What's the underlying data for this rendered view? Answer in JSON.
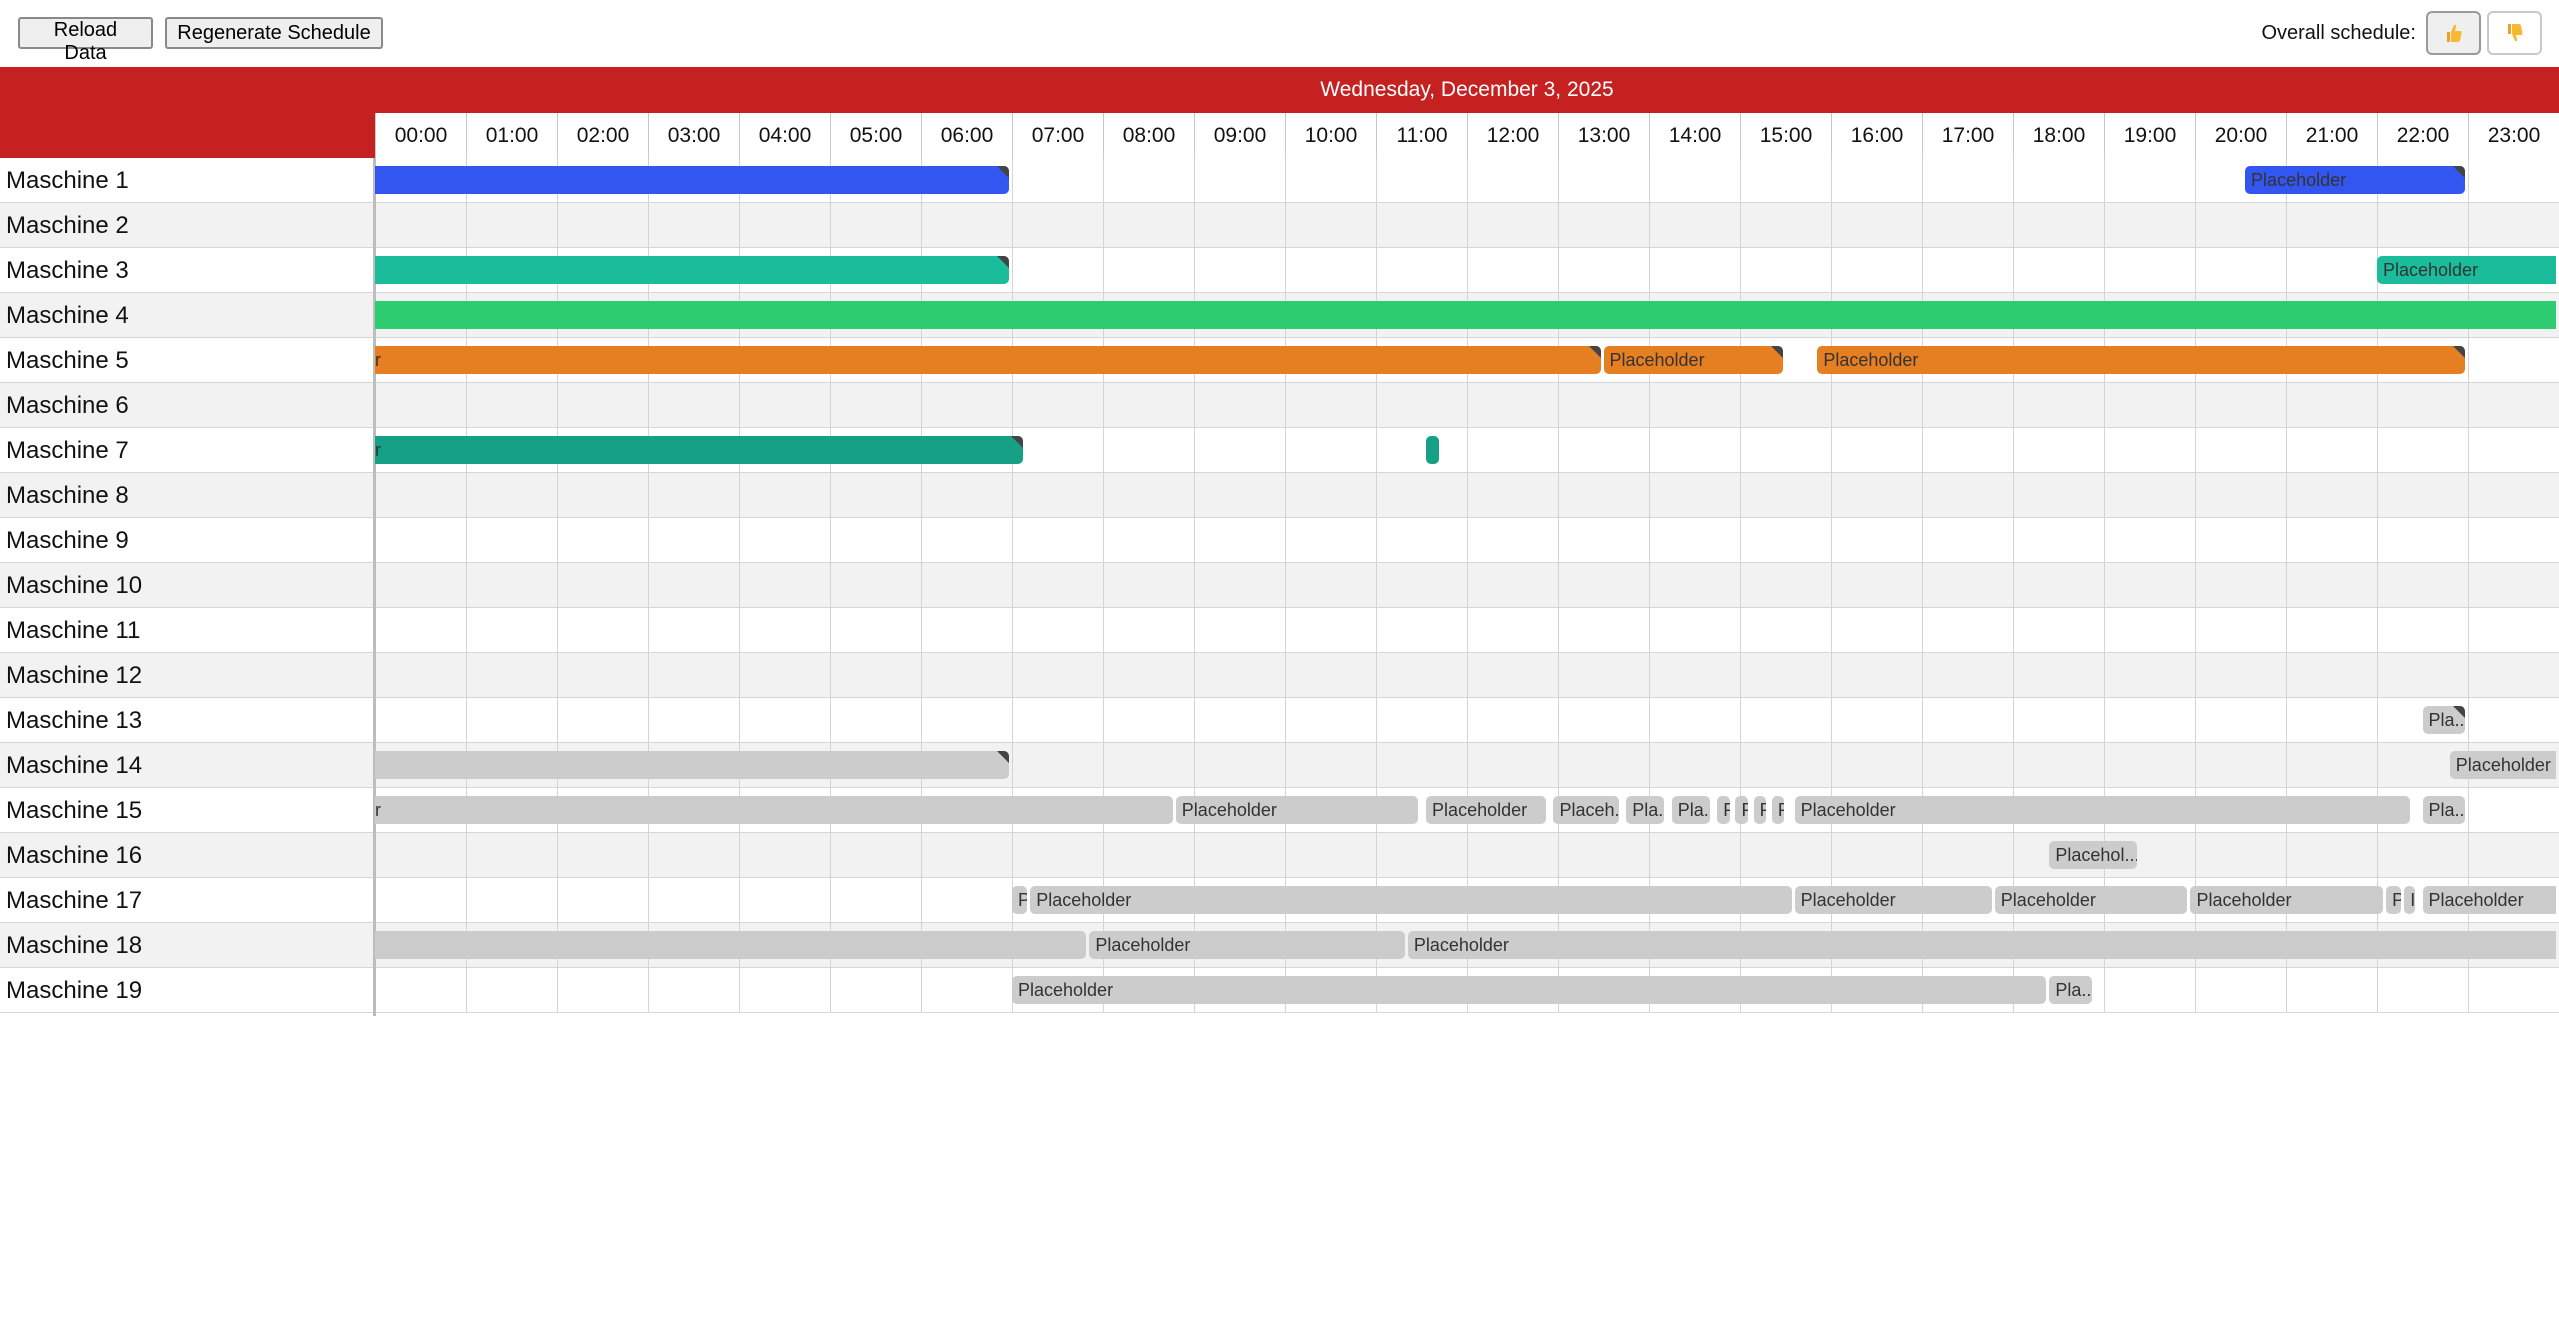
{
  "toolbar": {
    "reload_label": "Reload Data",
    "regenerate_label": "Regenerate Schedule",
    "overall_label": "Overall schedule:",
    "thumbs_up_icon": "thumbs-up-icon",
    "thumbs_down_icon": "thumbs-down-icon"
  },
  "header": {
    "date": "Wednesday, December 3, 2025",
    "hours": [
      "00:00",
      "01:00",
      "02:00",
      "03:00",
      "04:00",
      "05:00",
      "06:00",
      "07:00",
      "08:00",
      "09:00",
      "10:00",
      "11:00",
      "12:00",
      "13:00",
      "14:00",
      "15:00",
      "16:00",
      "17:00",
      "18:00",
      "19:00",
      "20:00",
      "21:00",
      "22:00",
      "23:00"
    ]
  },
  "colors": {
    "header_red": "#c62121",
    "blue": "#3355f0",
    "teal": "#1abc9c",
    "green": "#2ecc71",
    "orange": "#e67e22",
    "dark_teal": "#16a085",
    "gray": "#cccccc"
  },
  "machines": [
    {
      "name": "Maschine 1",
      "bars": [
        {
          "start": -0.5,
          "end": 7.0,
          "color": "#3355f0",
          "label": "",
          "flag": true
        },
        {
          "start": 20.55,
          "end": 23.0,
          "color": "#3355f0",
          "label": "Placeholder",
          "flag": true
        }
      ]
    },
    {
      "name": "Maschine 2",
      "bars": []
    },
    {
      "name": "Maschine 3",
      "bars": [
        {
          "start": -0.5,
          "end": 7.0,
          "color": "#1abc9c",
          "label": "",
          "flag": true
        },
        {
          "start": 22.0,
          "end": 24.5,
          "color": "#1abc9c",
          "label": "Placeholder",
          "flag": false
        }
      ]
    },
    {
      "name": "Maschine 4",
      "bars": [
        {
          "start": -0.5,
          "end": 24.5,
          "color": "#2ecc71",
          "label": "",
          "flag": false
        }
      ]
    },
    {
      "name": "Maschine 5",
      "bars": [
        {
          "start": -0.5,
          "end": 13.5,
          "color": "#e67e22",
          "label": "r",
          "flag": true
        },
        {
          "start": 13.5,
          "end": 15.5,
          "color": "#e67e22",
          "label": "Placeholder",
          "flag": true
        },
        {
          "start": 15.85,
          "end": 23.0,
          "color": "#e67e22",
          "label": "Placeholder",
          "flag": true
        }
      ]
    },
    {
      "name": "Maschine 6",
      "bars": []
    },
    {
      "name": "Maschine 7",
      "bars": [
        {
          "start": -0.5,
          "end": 7.15,
          "color": "#16a085",
          "label": "r",
          "flag": true
        },
        {
          "start": 11.55,
          "end": 11.72,
          "color": "#16a085",
          "label": "",
          "flag": false
        }
      ]
    },
    {
      "name": "Maschine 8",
      "bars": []
    },
    {
      "name": "Maschine 9",
      "bars": []
    },
    {
      "name": "Maschine 10",
      "bars": []
    },
    {
      "name": "Maschine 11",
      "bars": []
    },
    {
      "name": "Maschine 12",
      "bars": []
    },
    {
      "name": "Maschine 13",
      "bars": [
        {
          "start": 22.5,
          "end": 23.0,
          "color": "#cccccc",
          "label": "Pla...",
          "flag": true
        }
      ]
    },
    {
      "name": "Maschine 14",
      "bars": [
        {
          "start": -0.5,
          "end": 7.0,
          "color": "#cccccc",
          "label": "",
          "flag": true
        },
        {
          "start": 22.8,
          "end": 24.5,
          "color": "#cccccc",
          "label": "Placeholder",
          "flag": false
        }
      ]
    },
    {
      "name": "Maschine 15",
      "bars": [
        {
          "start": -0.5,
          "end": 8.8,
          "color": "#cccccc",
          "label": "r",
          "flag": false
        },
        {
          "start": 8.8,
          "end": 11.5,
          "color": "#cccccc",
          "label": "Placeholder",
          "flag": false
        },
        {
          "start": 11.55,
          "end": 12.9,
          "color": "#cccccc",
          "label": "Placeholder",
          "flag": false
        },
        {
          "start": 12.95,
          "end": 13.7,
          "color": "#cccccc",
          "label": "Placeh...",
          "flag": false
        },
        {
          "start": 13.75,
          "end": 14.2,
          "color": "#cccccc",
          "label": "Pla...",
          "flag": false
        },
        {
          "start": 14.25,
          "end": 14.7,
          "color": "#cccccc",
          "label": "Pla...",
          "flag": false
        },
        {
          "start": 14.75,
          "end": 14.92,
          "color": "#cccccc",
          "label": "P",
          "flag": false
        },
        {
          "start": 14.95,
          "end": 15.12,
          "color": "#cccccc",
          "label": "P",
          "flag": false
        },
        {
          "start": 15.15,
          "end": 15.32,
          "color": "#cccccc",
          "label": "P",
          "flag": false
        },
        {
          "start": 15.35,
          "end": 15.52,
          "color": "#cccccc",
          "label": "P",
          "flag": false
        },
        {
          "start": 15.6,
          "end": 22.4,
          "color": "#cccccc",
          "label": "Placeholder",
          "flag": false
        },
        {
          "start": 22.5,
          "end": 23.0,
          "color": "#cccccc",
          "label": "Pla...",
          "flag": false
        }
      ]
    },
    {
      "name": "Maschine 16",
      "bars": [
        {
          "start": 18.4,
          "end": 19.4,
          "color": "#cccccc",
          "label": "Placehol...",
          "flag": false
        }
      ]
    },
    {
      "name": "Maschine 17",
      "bars": [
        {
          "start": 7.0,
          "end": 7.2,
          "color": "#cccccc",
          "label": "P",
          "flag": false
        },
        {
          "start": 7.2,
          "end": 15.6,
          "color": "#cccccc",
          "label": "Placeholder",
          "flag": false
        },
        {
          "start": 15.6,
          "end": 17.8,
          "color": "#cccccc",
          "label": "Placeholder",
          "flag": false
        },
        {
          "start": 17.8,
          "end": 19.95,
          "color": "#cccccc",
          "label": "Placeholder",
          "flag": false
        },
        {
          "start": 19.95,
          "end": 22.1,
          "color": "#cccccc",
          "label": "Placeholder",
          "flag": false
        },
        {
          "start": 22.1,
          "end": 22.3,
          "color": "#cccccc",
          "label": "P",
          "flag": false
        },
        {
          "start": 22.3,
          "end": 22.45,
          "color": "#cccccc",
          "label": "I",
          "flag": false
        },
        {
          "start": 22.5,
          "end": 24.5,
          "color": "#cccccc",
          "label": "Placeholder",
          "flag": false
        }
      ]
    },
    {
      "name": "Maschine 18",
      "bars": [
        {
          "start": -0.5,
          "end": 7.85,
          "color": "#cccccc",
          "label": "",
          "flag": false
        },
        {
          "start": 7.85,
          "end": 11.35,
          "color": "#cccccc",
          "label": "Placeholder",
          "flag": false
        },
        {
          "start": 11.35,
          "end": 24.5,
          "color": "#cccccc",
          "label": "Placeholder",
          "flag": false
        }
      ]
    },
    {
      "name": "Maschine 19",
      "bars": [
        {
          "start": 7.0,
          "end": 18.4,
          "color": "#cccccc",
          "label": "Placeholder",
          "flag": false
        },
        {
          "start": 18.4,
          "end": 18.9,
          "color": "#cccccc",
          "label": "Pla...",
          "flag": false
        }
      ]
    }
  ]
}
